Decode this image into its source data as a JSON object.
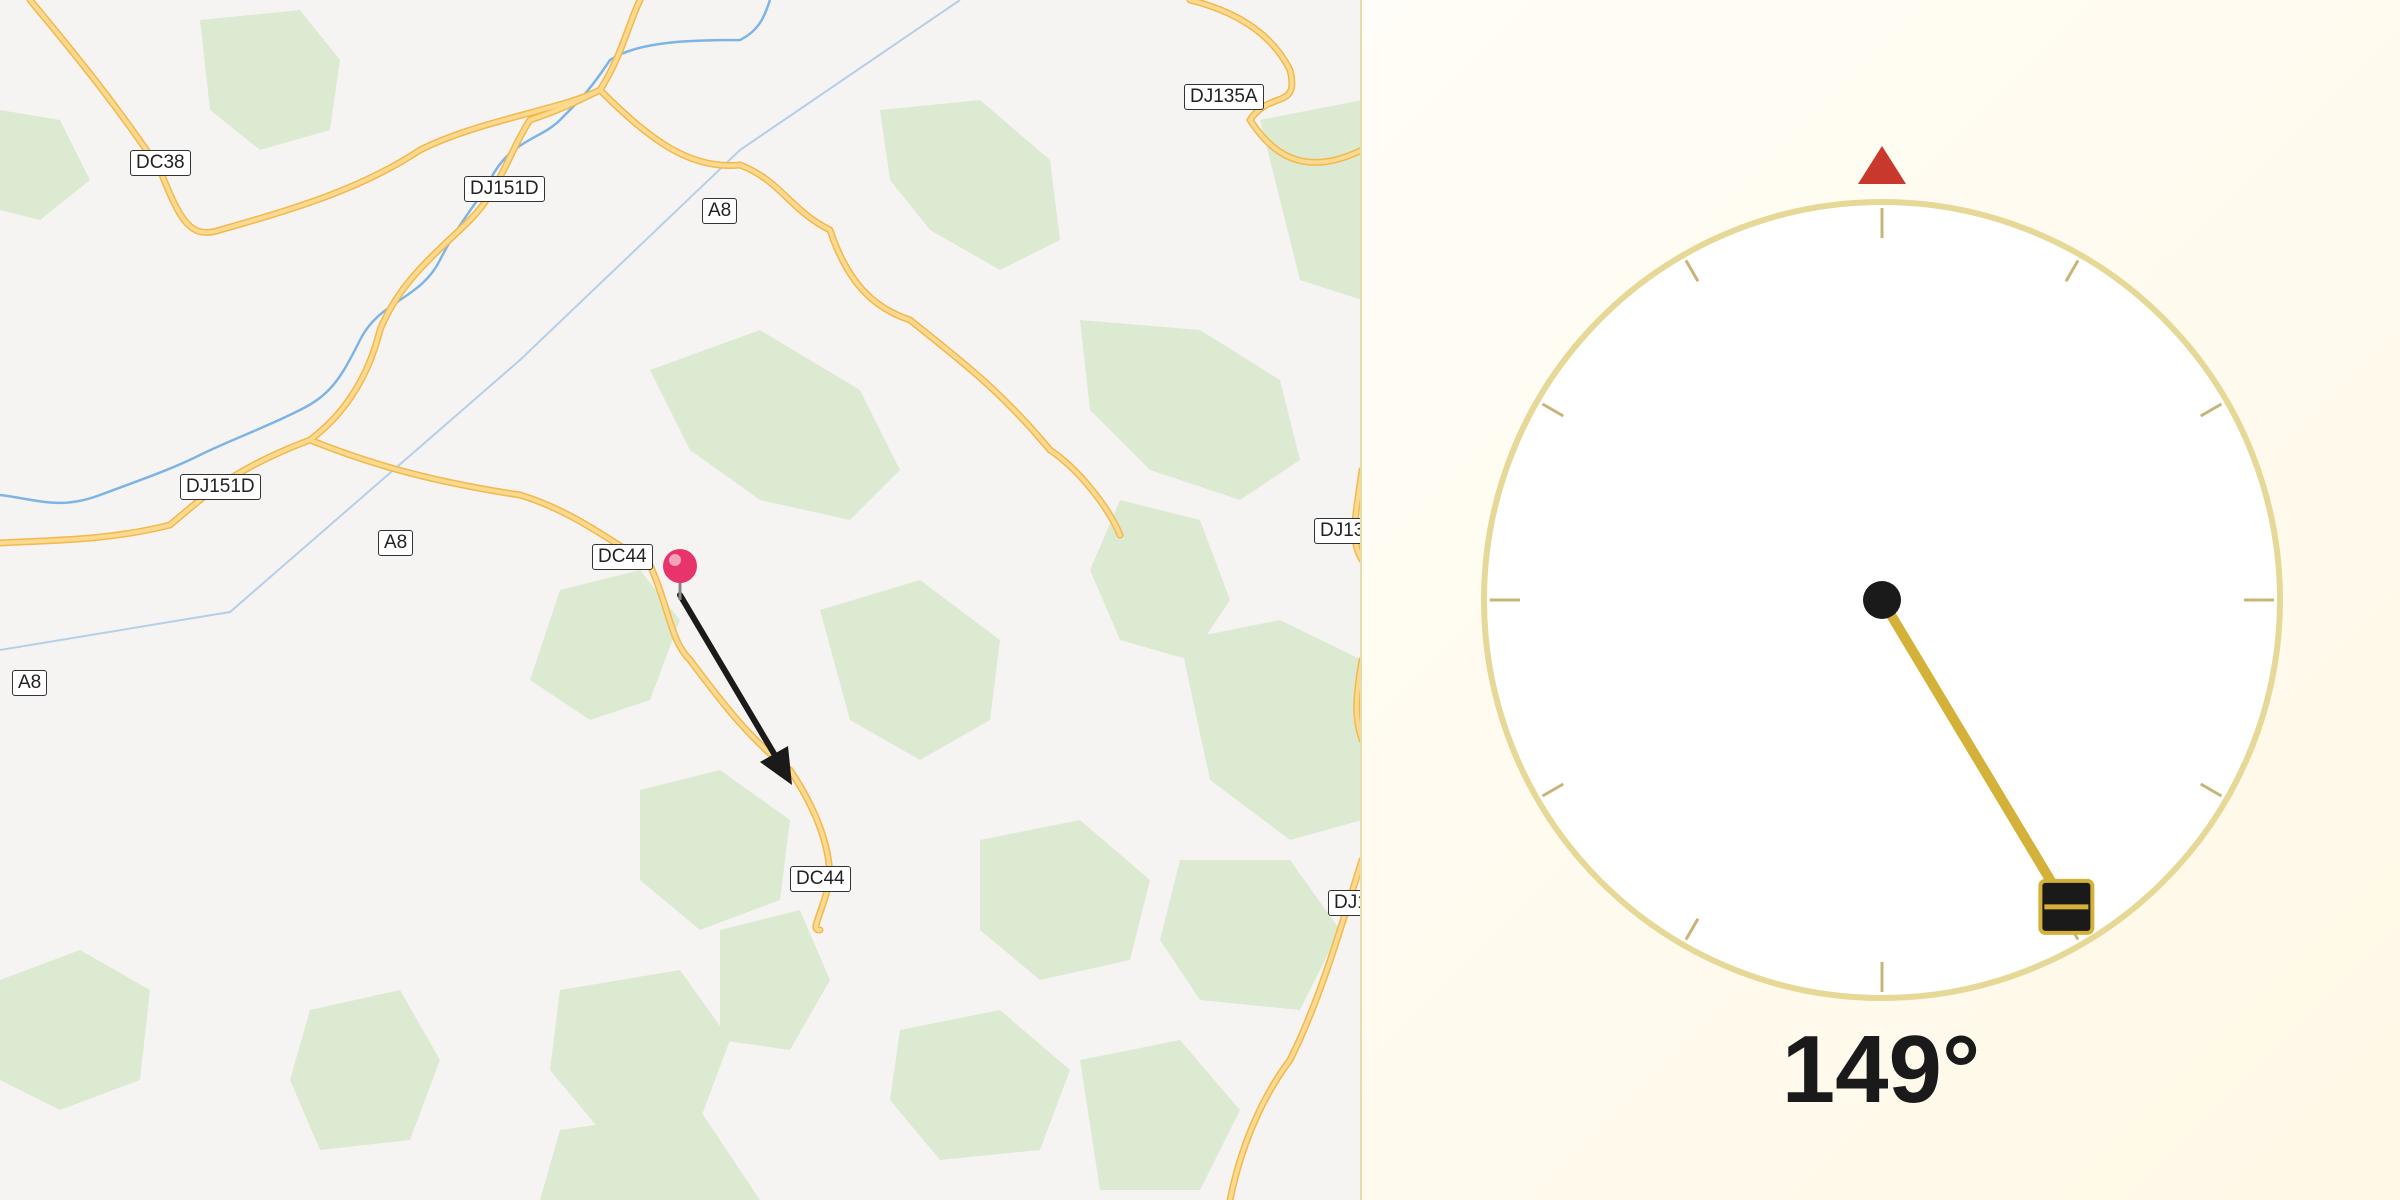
{
  "map": {
    "road_labels": [
      "DC38",
      "DJ151D",
      "A8",
      "DJ135A",
      "DJ151D",
      "A8",
      "DC44",
      "A8",
      "DC44",
      "DJ13",
      "DJ1"
    ],
    "pin_color": "#e8336b",
    "arrow_color": "#1a1a1a",
    "road_color": "#f7c96e",
    "river_color": "#7db4e6",
    "forest_color": "#dcead2"
  },
  "dial": {
    "heading_degrees": 149,
    "heading_text": "149°",
    "north_marker_color": "#c8382c",
    "needle_color": "#d4b23a",
    "ring_color": "#e6d896"
  }
}
